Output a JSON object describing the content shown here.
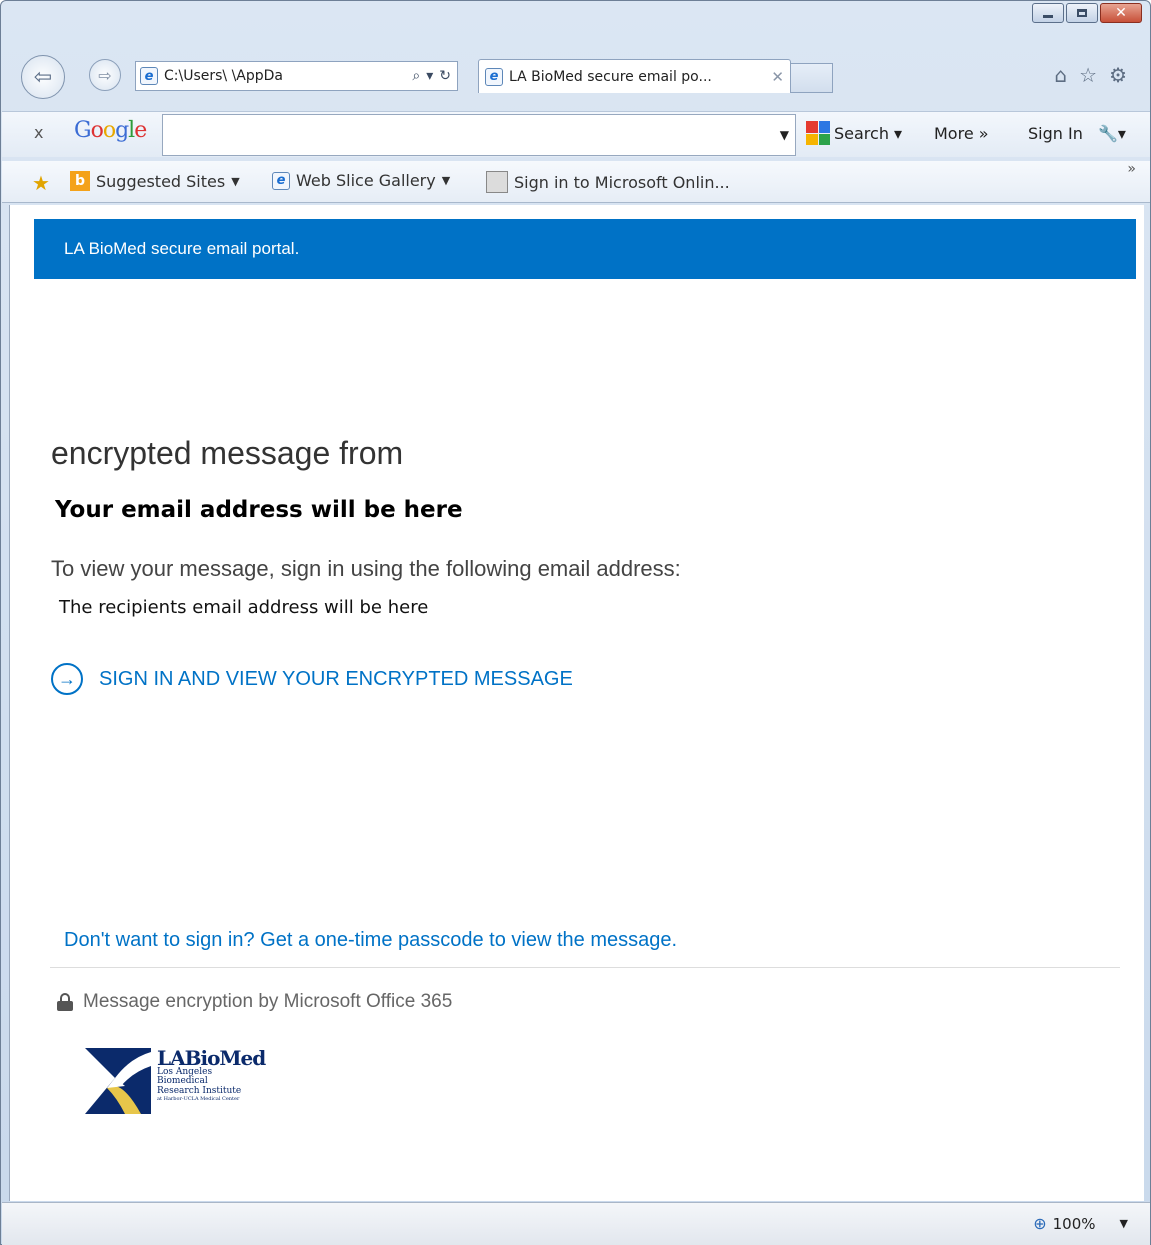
{
  "browser": {
    "address": "C:\\Users\\          \\AppDa",
    "tab_title": "LA BioMed secure email po...",
    "tab_close": "✕",
    "icons": [
      "back-icon",
      "forward-icon",
      "home-icon",
      "favorites-star-icon",
      "gear-icon"
    ]
  },
  "google_toolbar": {
    "close": "x",
    "logo": "Google",
    "search_value": "",
    "search_label": "Search",
    "more_label": "More »",
    "signin_label": "Sign In"
  },
  "favorites_bar": {
    "items": [
      {
        "label": "Suggested Sites"
      },
      {
        "label": "Web Slice Gallery"
      },
      {
        "label": "Sign in to Microsoft Onlin..."
      }
    ]
  },
  "page": {
    "banner": "LA BioMed secure email portal.",
    "heading": "encrypted message from",
    "email_heading": "Your email address will be here",
    "instructions": "To view your message, sign in using the following email address:",
    "recipient": "The recipients email address will be here",
    "signin_link": "SIGN IN AND VIEW YOUR ENCRYPTED MESSAGE",
    "otp_link": "Don't want to sign in? Get a one-time passcode to view the message.",
    "encryption_note": "Message encryption by Microsoft Office 365",
    "logo": {
      "name": "LABioMed",
      "line1": "Los Angeles",
      "line2": "Biomedical",
      "line3": "Research Institute",
      "line4": "at Harbor-UCLA Medical Center"
    },
    "accent_color": "#0072c6"
  },
  "status_bar": {
    "zoom": "100%"
  }
}
